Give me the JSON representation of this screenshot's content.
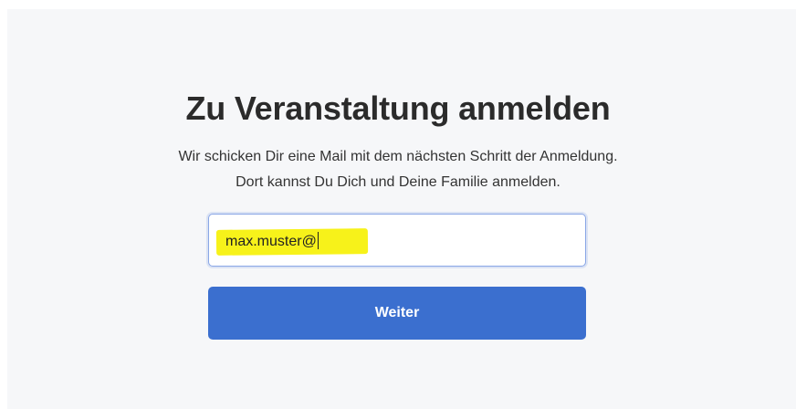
{
  "form": {
    "title": "Zu Veranstaltung anmelden",
    "subtitle_line1": "Wir schicken Dir eine Mail mit dem nächsten Schritt der Anmeldung.",
    "subtitle_line2": "Dort kannst Du Dich und Deine Familie anmelden.",
    "email_value": "max.muster@",
    "submit_label": "Weiter"
  },
  "colors": {
    "panel_background": "#f6f7f9",
    "button_background": "#3b6fcf",
    "input_focus_border": "#8aa7e6",
    "annotation_highlight": "#f7f21a"
  }
}
